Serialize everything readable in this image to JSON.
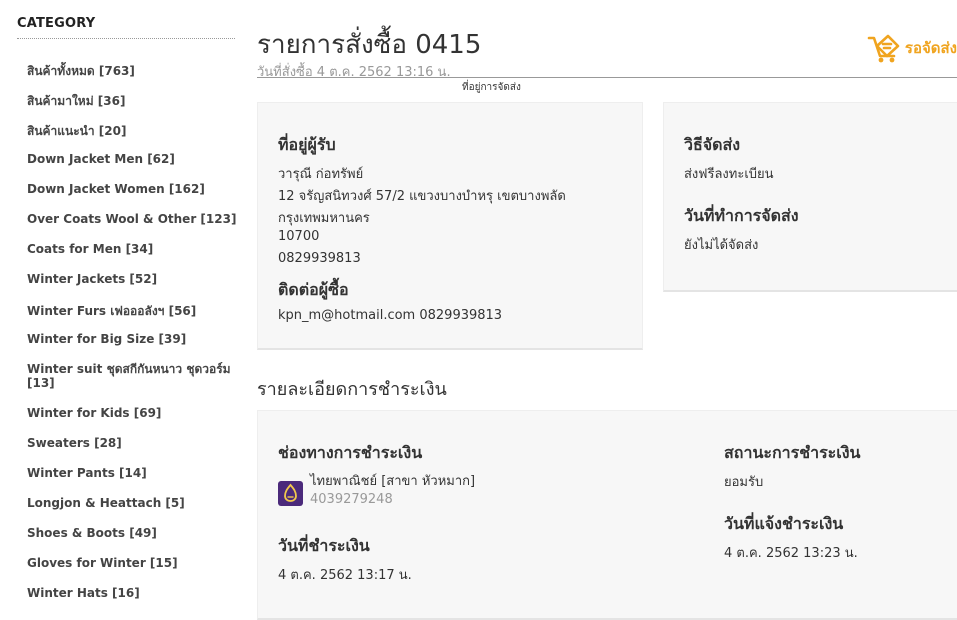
{
  "sidebar": {
    "title": "CATEGORY",
    "items": [
      {
        "label": "สินค้าทั้งหมด [763]"
      },
      {
        "label": "สินค้ามาใหม่ [36]"
      },
      {
        "label": "สินค้าแนะนำ [20]"
      },
      {
        "label": "Down Jacket Men [62]"
      },
      {
        "label": "Down Jacket Women [162]"
      },
      {
        "label": "Over Coats Wool & Other [123]"
      },
      {
        "label": "Coats for Men [34]"
      },
      {
        "label": "Winter Jackets [52]"
      },
      {
        "label": "Winter Furs เฟอออลังฯ [56]"
      },
      {
        "label": "Winter for Big Size [39]"
      },
      {
        "label": "Winter suit ชุดสกีกันหนาว ชุดวอร์ม [13]"
      },
      {
        "label": "Winter for Kids [69]"
      },
      {
        "label": "Sweaters [28]"
      },
      {
        "label": "Winter Pants [14]"
      },
      {
        "label": "Longjon & Heattach [5]"
      },
      {
        "label": "Shoes & Boots [49]"
      },
      {
        "label": "Gloves for Winter [15]"
      },
      {
        "label": "Winter Hats [16]"
      }
    ]
  },
  "order": {
    "title": "รายการสั่งซื้อ 0415",
    "date": "วันที่สั่งซื้อ 4 ต.ค. 2562 13:16 น.",
    "ship_link": "ที่อยู่การจัดส่ง",
    "status": "รอจัดส่ง",
    "status_icon": "cart-icon",
    "status_color": "#f0a41f"
  },
  "recipient": {
    "heading": "ที่อยู่ผู้รับ",
    "name": "วารุณี ก่อทรัพย์",
    "address1": "12 จรัญสนิทวงศ์ 57/2 แขวงบางบำหรุ เขตบางพลัด",
    "city": "กรุงเทพมหานคร",
    "postcode": "10700",
    "phone": "0829939813",
    "contact_heading": "ติดต่อผู้ซื้อ",
    "contact": "kpn_m@hotmail.com 0829939813"
  },
  "shipping": {
    "method_heading": "วิธีจัดส่ง",
    "method": "ส่งฟรีลงทะเบียน",
    "date_heading": "วันที่ทำการจัดส่ง",
    "date": "ยังไม่ได้จัดส่ง"
  },
  "payment": {
    "section_title": "รายละเอียดการชำระเงิน",
    "channel_heading": "ช่องทางการชำระเงิน",
    "bank": "ไทยพาณิชย์ [สาขา หัวหมาก]",
    "account": "4039279248",
    "bank_icon": "scb-bank-icon",
    "pay_date_heading": "วันที่ชำระเงิน",
    "pay_date": "4 ต.ค. 2562 13:17 น.",
    "status_heading": "สถานะการชำระเงิน",
    "status": "ยอมรับ",
    "notify_heading": "วันที่แจ้งชำระเงิน",
    "notify_date": "4 ต.ค. 2562 13:23 น."
  }
}
